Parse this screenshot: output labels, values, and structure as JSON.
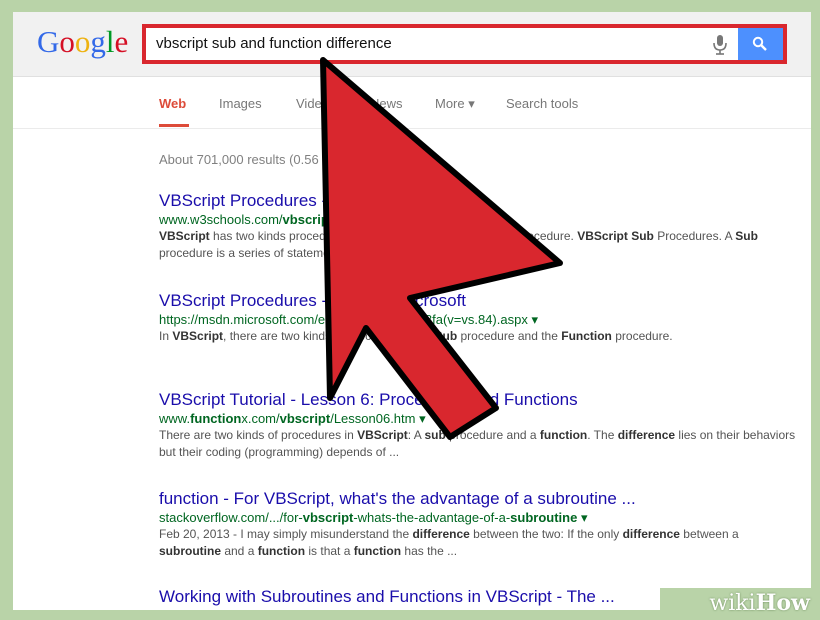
{
  "logo": {
    "letters": [
      "G",
      "o",
      "o",
      "g",
      "l",
      "e"
    ],
    "colors": [
      "#3369e8",
      "#d50f25",
      "#eeb211",
      "#3369e8",
      "#009925",
      "#d50f25"
    ]
  },
  "search": {
    "query": "vbscript sub and function difference",
    "highlight_color": "#d9272e"
  },
  "tabs": [
    {
      "label": "Web",
      "active": true
    },
    {
      "label": "Images",
      "active": false
    },
    {
      "label": "Videos",
      "active": false
    },
    {
      "label": "News",
      "active": false
    },
    {
      "label": "More ▾",
      "active": false
    },
    {
      "label": "Search tools",
      "active": false
    }
  ],
  "results_stats": "About 701,000 results (0.56 seconds)",
  "results": [
    {
      "title": "VBScript Procedures - W3Schools",
      "url_html": "www.w3schools.com/<b>vbscript</b>/vbscript_procedures.asp ▾",
      "snippet_html": "<b>VBScript</b> has two kinds procedures: <b>Sub</b> procedure and <b>Function</b> procedure. <b>VBScript Sub</b> Procedures. A <b>Sub</b> procedure is a series of statements, enclosed by the  ..."
    },
    {
      "title": "VBScript Procedures - MSDN - Microsoft",
      "url_html": "https://msdn.microsoft.com/en-us/library/x7hbf8fa(v=vs.84).aspx ▾",
      "snippet_html": "In <b>VBScript</b>, there are two kinds of procedures; the <b>Sub</b> procedure and the <b>Function</b> procedure."
    },
    {
      "title": "VBScript Tutorial - Lesson 6: Procedures and Functions",
      "url_html": "www.<b>function</b>x.com/<b>vbscript</b>/Lesson06.htm ▾",
      "snippet_html": "There are two kinds of procedures in <b>VBScript</b>: A <b>sub</b> procedure and a <b>function</b>. The <b>difference</b> lies on their behaviors but their coding (programming) depends of  ..."
    },
    {
      "title": "function - For VBScript, what's the advantage of a subroutine ...",
      "url_html": "stackoverflow.com/.../for-<b>vbscript</b>-whats-the-advantage-of-a-<b>subroutine</b> ▾",
      "snippet_html": "Feb 20, 2013 - I may simply misunderstand the <b>difference</b> between the two: If the only <b>difference</b> between a <b>subroutine</b> and a <b>function</b> is that a <b>function</b> has the  ..."
    },
    {
      "title": "Working with Subroutines and Functions in VBScript - The ...",
      "url_html": "",
      "snippet_html": ""
    }
  ],
  "watermark": {
    "part1": "wiki",
    "part2": "How"
  }
}
